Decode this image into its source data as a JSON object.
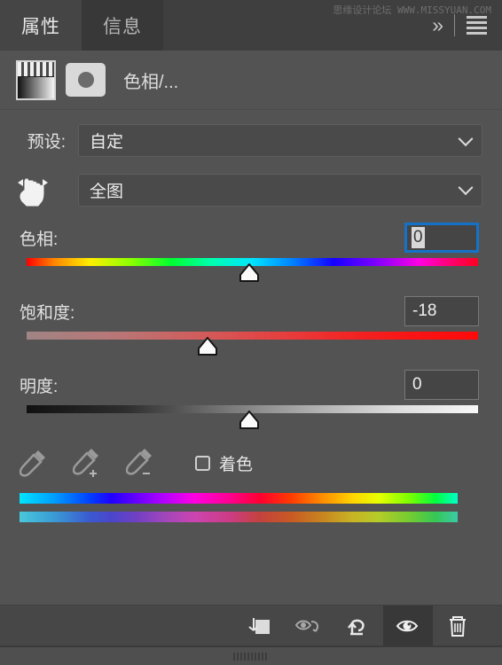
{
  "window": {
    "watermark": "思缘设计论坛 WWW.MISSYUAN.COM"
  },
  "tabs": [
    {
      "label": "属性",
      "active": true
    },
    {
      "label": "信息",
      "active": false
    }
  ],
  "panel_controls": {
    "collapse_label": "»",
    "menu_name": "panel-menu"
  },
  "layer_header": {
    "title": "色相/...",
    "adjustment_thumb": "hue-saturation-thumbnail",
    "mask_thumb": "layer-mask-thumbnail"
  },
  "preset": {
    "label": "预设:",
    "value": "自定"
  },
  "range": {
    "icon": "on-image-adjust-icon",
    "value": "全图"
  },
  "sliders": [
    {
      "id": "hue",
      "label": "色相:",
      "value": "0",
      "focused": true,
      "thumb_pct": 50.0,
      "track": "hue"
    },
    {
      "id": "saturation",
      "label": "饱和度:",
      "value": "-18",
      "focused": false,
      "thumb_pct": 41.0,
      "track": "sat"
    },
    {
      "id": "lightness",
      "label": "明度:",
      "value": "0",
      "focused": false,
      "thumb_pct": 50.0,
      "track": "light"
    }
  ],
  "tools": {
    "eyedroppers": [
      "eyedropper-icon",
      "eyedropper-add-icon",
      "eyedropper-subtract-icon"
    ],
    "colorize": {
      "label": "着色",
      "checked": false
    }
  },
  "spectrum": {
    "top_name": "source-color-spectrum",
    "bottom_name": "result-color-spectrum"
  },
  "bottom_toolbar": [
    {
      "name": "clip-to-layer-button",
      "icon": "clip-to-layer-icon",
      "active": false
    },
    {
      "name": "toggle-preview-button",
      "icon": "eye-arrow-icon",
      "active": false
    },
    {
      "name": "reset-button",
      "icon": "reset-arrow-icon",
      "active": false
    },
    {
      "name": "visibility-button",
      "icon": "eye-icon",
      "active": true
    },
    {
      "name": "delete-button",
      "icon": "trash-icon",
      "active": false
    }
  ]
}
